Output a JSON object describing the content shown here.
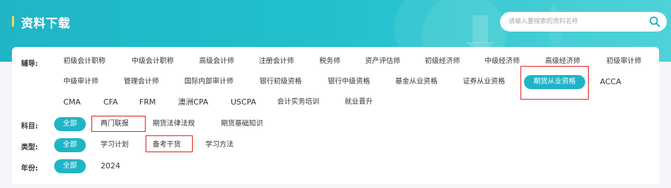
{
  "header": {
    "title": "资料下载",
    "search_placeholder": "请输入要搜索的资料名称"
  },
  "filters": {
    "coach": {
      "label": "辅导:",
      "items": [
        "初级会计职称",
        "中级会计职称",
        "高级会计师",
        "注册会计师",
        "税务师",
        "资产评估师",
        "初级经济师",
        "中级经济师",
        "高级经济师",
        "初级审计师",
        "中级审计师",
        "管理会计师",
        "国际内部审计师",
        "银行初级资格",
        "银行中级资格",
        "基金从业资格",
        "证券从业资格",
        "期货从业资格",
        "ACCA",
        "CMA",
        "CFA",
        "FRM",
        "澳洲CPA",
        "USCPA",
        "会计实务培训",
        "就业晋升"
      ],
      "selected": "期货从业资格"
    },
    "subject": {
      "label": "科目:",
      "all": "全部",
      "items": [
        "两门联报",
        "期货法律法规",
        "期货基础知识"
      ]
    },
    "type": {
      "label": "类型:",
      "all": "全部",
      "items": [
        "学习计划",
        "备考干货",
        "学习方法"
      ]
    },
    "year": {
      "label": "年份:",
      "all": "全部",
      "items": [
        "2024"
      ]
    }
  },
  "colors": {
    "accent": "#1fb5c6",
    "highlight_box": "#e02020",
    "title_bar": "#ffd84d"
  }
}
